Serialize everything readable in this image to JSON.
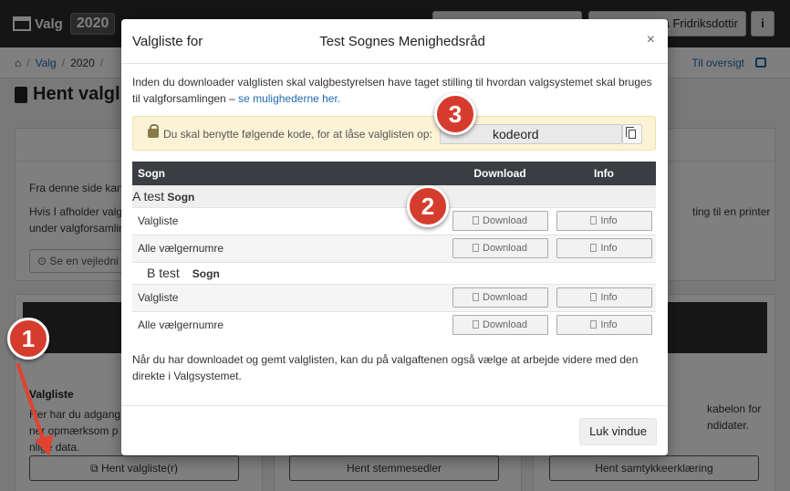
{
  "app": {
    "brand": "Valg",
    "year": "2020",
    "user_button": "a Fridriksdottir",
    "info_button": "i"
  },
  "breadcrumb": {
    "item1": "Valg",
    "item2": "2020",
    "right_link": "Til oversigt"
  },
  "page": {
    "title": "Hent valgl",
    "info_text_1": "Fra denne side kan",
    "info_text_2": "Hvis I afholder valg",
    "info_text_3": "under valgforsamlin",
    "guide_button": "Se en vejledni",
    "info_right_text": "ting til en printer",
    "col1_heading": "Valgliste",
    "col1_text_1": "Her har du adgang",
    "col1_text_2": "ner opmærksom p",
    "col1_text_3": "nlige data.",
    "col1_button": "Hent valgliste(r)",
    "col2_button": "Hent stemmesedler",
    "col3_text_1": "kabelon for",
    "col3_text_2": "ndidater.",
    "col3_button": "Hent samtykkeerklæring"
  },
  "modal": {
    "title_prefix": "Valgliste for",
    "title_name_1": "Test",
    "title_name_2": "Sognes Menighedsråd",
    "close_icon": "×",
    "intro_text": "Inden du downloader valglisten skal valgbestyrelsen have taget stilling til hvordan valgsystemet skal bruges til valgforsamlingen –",
    "intro_link": "se mulighederne her.",
    "alert_text": "Du skal benytte følgende kode, for at låse valglisten op:",
    "code_value": "kodeord",
    "table": {
      "col_sogn": "Sogn",
      "col_download": "Download",
      "col_info": "Info",
      "groups": [
        {
          "name": "A test",
          "suffix": "Sogn",
          "rows": [
            {
              "label": "Valgliste",
              "download": "Download",
              "info": "Info"
            },
            {
              "label": "Alle vælgernumre",
              "download": "Download",
              "info": "Info"
            }
          ]
        },
        {
          "name": "B test",
          "suffix": "Sogn",
          "rows": [
            {
              "label": "Valgliste",
              "download": "Download",
              "info": "Info"
            },
            {
              "label": "Alle vælgernumre",
              "download": "Download",
              "info": "Info"
            }
          ]
        }
      ]
    },
    "outro_text": "Når du har downloadet og gemt valglisten, kan du på valgaftenen også vælge at arbejde videre med den direkte i Valgsystemet.",
    "close_button": "Luk vindue"
  },
  "callouts": [
    "1",
    "2",
    "3"
  ],
  "colors": {
    "callout": "#d63c2e",
    "alert_bg": "#fcf3d6",
    "table_header": "#3a3d42",
    "link": "#1f6ab1"
  }
}
